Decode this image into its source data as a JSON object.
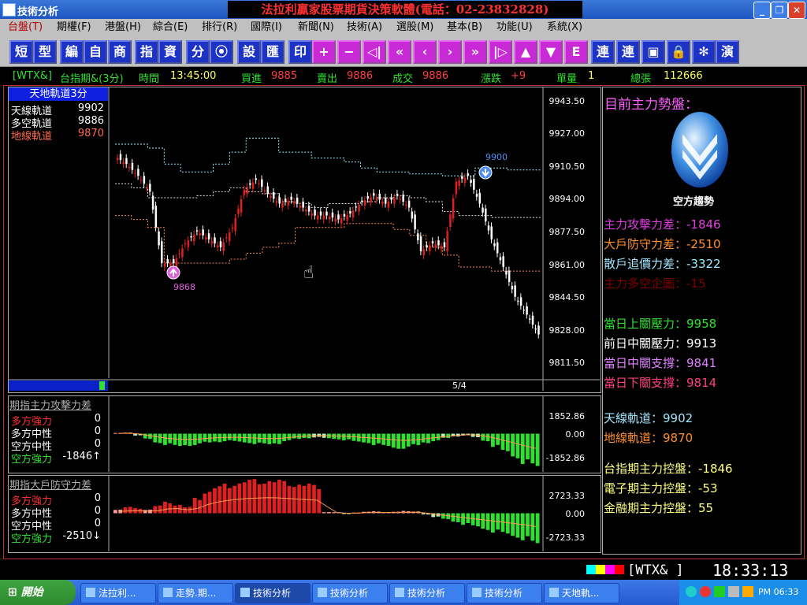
{
  "window": {
    "app_title": "技術分析",
    "banner": "法拉利贏家股票期貨決策軟體(電話：02-23832828)",
    "controls": [
      "_",
      "❐",
      "✕"
    ]
  },
  "menu": {
    "items": [
      {
        "label": "台盤(T)",
        "style": "red"
      },
      {
        "label": "期權(F)",
        "style": "normal"
      },
      {
        "label": "港盤(H)",
        "style": "normal"
      },
      {
        "label": "綜合(E)",
        "style": "normal"
      },
      {
        "label": "排行(R)",
        "style": "normal"
      },
      {
        "label": "國際(I)",
        "style": "normal"
      },
      {
        "label": "新聞(N)",
        "style": "normal"
      },
      {
        "label": "技術(A)",
        "style": "normal"
      },
      {
        "label": "選股(M)",
        "style": "normal"
      },
      {
        "label": "基本(B)",
        "style": "normal"
      },
      {
        "label": "功能(U)",
        "style": "normal"
      },
      {
        "label": "系統(X)",
        "style": "normal"
      }
    ]
  },
  "toolbar": {
    "buttons": [
      "短",
      "型",
      "編",
      "自",
      "商",
      "指",
      "資",
      "分",
      "⦿",
      "設",
      "匯",
      "印",
      "+",
      "−",
      "◁|",
      "«",
      "‹",
      "›",
      "»",
      "|▷",
      "▲",
      "▼",
      "E",
      "連",
      "連",
      "▣",
      "🔒",
      "✻",
      "演"
    ]
  },
  "quote": {
    "symbol": "[WTX&]",
    "name": "台指期&(3分)",
    "time_label": "時間",
    "time": "13:45:00",
    "bid_label": "買進",
    "bid": "9885",
    "ask_label": "賣出",
    "ask": "9886",
    "trade_label": "成交",
    "trade": "9886",
    "change_label": "漲跌",
    "change": "+9",
    "vol_label": "單量",
    "vol": "1",
    "total_label": "總張",
    "total": "112666"
  },
  "main_chart": {
    "legend_title": "天地軌道3分",
    "legend": [
      {
        "label": "天線軌道",
        "value": "9902",
        "color": "#ffffff"
      },
      {
        "label": "多空軌道",
        "value": "9886",
        "color": "#ffffff"
      },
      {
        "label": "地線軌道",
        "value": "9870",
        "color": "#ff6a4a"
      }
    ],
    "y_ticks": [
      "9943.50",
      "9927.00",
      "9910.50",
      "9894.00",
      "9877.50",
      "9861.00",
      "9844.50",
      "9828.00",
      "9811.50"
    ],
    "marker_high": "9900",
    "marker_low": "9868",
    "page": "5/4"
  },
  "chart_data": [
    {
      "type": "line",
      "title": "天地軌道3分",
      "ylim": [
        9804,
        9951
      ],
      "series": [
        {
          "name": "天線軌道",
          "values": [
            9922,
            9922,
            9920,
            9912,
            9908,
            9908,
            9912,
            9918,
            9925,
            9925,
            9918,
            9918,
            9915,
            9915,
            9913,
            9910,
            9908,
            9908,
            9907,
            9907,
            9906,
            9906,
            9910,
            9910,
            9909,
            9909
          ]
        },
        {
          "name": "地線軌道",
          "values": [
            9886,
            9884,
            9880,
            9862,
            9862,
            9862,
            9862,
            9864,
            9867,
            9870,
            9872,
            9880,
            9880,
            9880,
            9882,
            9882,
            9882,
            9879,
            9876,
            9870,
            9866,
            9860,
            9860,
            9858,
            9858,
            9858
          ]
        },
        {
          "name": "多空軌道",
          "values": [
            9902,
            9900,
            9895,
            9895,
            9895,
            9896,
            9898,
            9900,
            9898,
            9897,
            9893,
            9892,
            9890,
            9892,
            9892,
            9893,
            9895,
            9896,
            9895,
            9893,
            9888,
            9886,
            9886,
            9885,
            9885,
            9885
          ]
        }
      ],
      "candles_close": [
        9912,
        9906,
        9898,
        9862,
        9862,
        9872,
        9878,
        9874,
        9870,
        9880,
        9899,
        9904,
        9897,
        9892,
        9894,
        9890,
        9886,
        9886,
        9884,
        9887,
        9893,
        9896,
        9892,
        9896,
        9890,
        9868,
        9872,
        9870,
        9903,
        9906,
        9892,
        9874,
        9860,
        9845,
        9836,
        9826
      ]
    },
    {
      "type": "bar",
      "title": "期指主力攻擊力差",
      "ylim": [
        -1852.86,
        1852.86
      ],
      "values": [
        40,
        60,
        -100,
        -300,
        -500,
        -600,
        -700,
        -650,
        -600,
        -500,
        -450,
        -400,
        -450,
        -500,
        -550,
        -600,
        -550,
        -400,
        -300,
        -250,
        -200,
        -260,
        -300,
        -350,
        -450,
        -500,
        -600,
        -700,
        -800,
        -800,
        -650,
        -500,
        -400,
        -250,
        -150,
        -100,
        -200,
        -400,
        -700,
        -1000,
        -1300,
        -1600,
        -1846
      ],
      "y_ticks": [
        "1852.86",
        "0.00",
        "-1852.86"
      ],
      "legend": [
        {
          "label": "多方強力",
          "value": "0"
        },
        {
          "label": "多方中性",
          "value": "0"
        },
        {
          "label": "空方中性",
          "value": "0"
        },
        {
          "label": "空方強力",
          "value": "-1846↑"
        }
      ]
    },
    {
      "type": "bar",
      "title": "期指大戶防守力差",
      "ylim": [
        -2723.33,
        2723.33
      ],
      "values": [
        300,
        500,
        400,
        300,
        600,
        900,
        700,
        500,
        1200,
        1800,
        2100,
        2300,
        2500,
        2600,
        2650,
        2700,
        2600,
        2500,
        2400,
        2300,
        2200,
        100,
        80,
        -50,
        60,
        120,
        150,
        100,
        120,
        180,
        150,
        -100,
        -300,
        -500,
        -700,
        -900,
        -1100,
        -1300,
        -1500,
        -1700,
        -1900,
        -2100,
        -2510
      ],
      "y_ticks": [
        "2723.33",
        "0.00",
        "-2723.33"
      ],
      "legend": [
        {
          "label": "多方強力",
          "value": "0"
        },
        {
          "label": "多方中性",
          "value": "0"
        },
        {
          "label": "空方中性",
          "value": "0"
        },
        {
          "label": "空方強力",
          "value": "-2510↓"
        }
      ]
    }
  ],
  "side_panel": {
    "heading": "目前主力勢盤：",
    "trend_label": "空方趨勢",
    "rows_a": [
      {
        "label": "主力攻擊力差：",
        "value": "-1846",
        "color": "#e040e0"
      },
      {
        "label": "大戶防守力差：",
        "value": "-2510",
        "color": "#ff9030"
      },
      {
        "label": "散戶追價力差：",
        "value": "-3322",
        "color": "#a0e8ff"
      },
      {
        "label": "主力多空企圖：",
        "value": "-15",
        "color": "#800000"
      }
    ],
    "rows_b": [
      {
        "label": "當日上關壓力：",
        "value": "9958",
        "color": "#30e030"
      },
      {
        "label": "前日中關壓力：",
        "value": "9913",
        "color": "#ffffff"
      },
      {
        "label": "當日中關支撐：",
        "value": "9841",
        "color": "#e080ff"
      },
      {
        "label": "當日下關支撐：",
        "value": "9814",
        "color": "#ff4080"
      }
    ],
    "rows_c": [
      {
        "label": "天線軌道：",
        "value": "9902",
        "color": "#a0e8ff"
      },
      {
        "label": "地線軌道：",
        "value": "9870",
        "color": "#ff9030"
      }
    ],
    "rows_d": [
      {
        "label": "台指期主力控盤：",
        "value": "-1846",
        "color": "#ffff80"
      },
      {
        "label": "電子期主力控盤：",
        "value": "-53",
        "color": "#ffff80"
      },
      {
        "label": "金融期主力控盤：",
        "value": "55",
        "color": "#ffff80"
      }
    ]
  },
  "status": {
    "symbol": "[WTX&  ]",
    "clock": "18:33:13"
  },
  "taskbar": {
    "start": "開始",
    "tasks": [
      {
        "label": "法拉利...",
        "active": false
      },
      {
        "label": "走勢.期...",
        "active": false
      },
      {
        "label": "技術分析",
        "active": true
      },
      {
        "label": "技術分析",
        "active": false
      },
      {
        "label": "技術分析",
        "active": false
      },
      {
        "label": "技術分析",
        "active": false
      },
      {
        "label": "天地軌...",
        "active": false
      }
    ],
    "tray_time": "PM 06:33"
  },
  "colors": {
    "up": "#e02020",
    "down": "#ffffff",
    "green": "#30e030",
    "panel_border": "#aaaaaa"
  }
}
